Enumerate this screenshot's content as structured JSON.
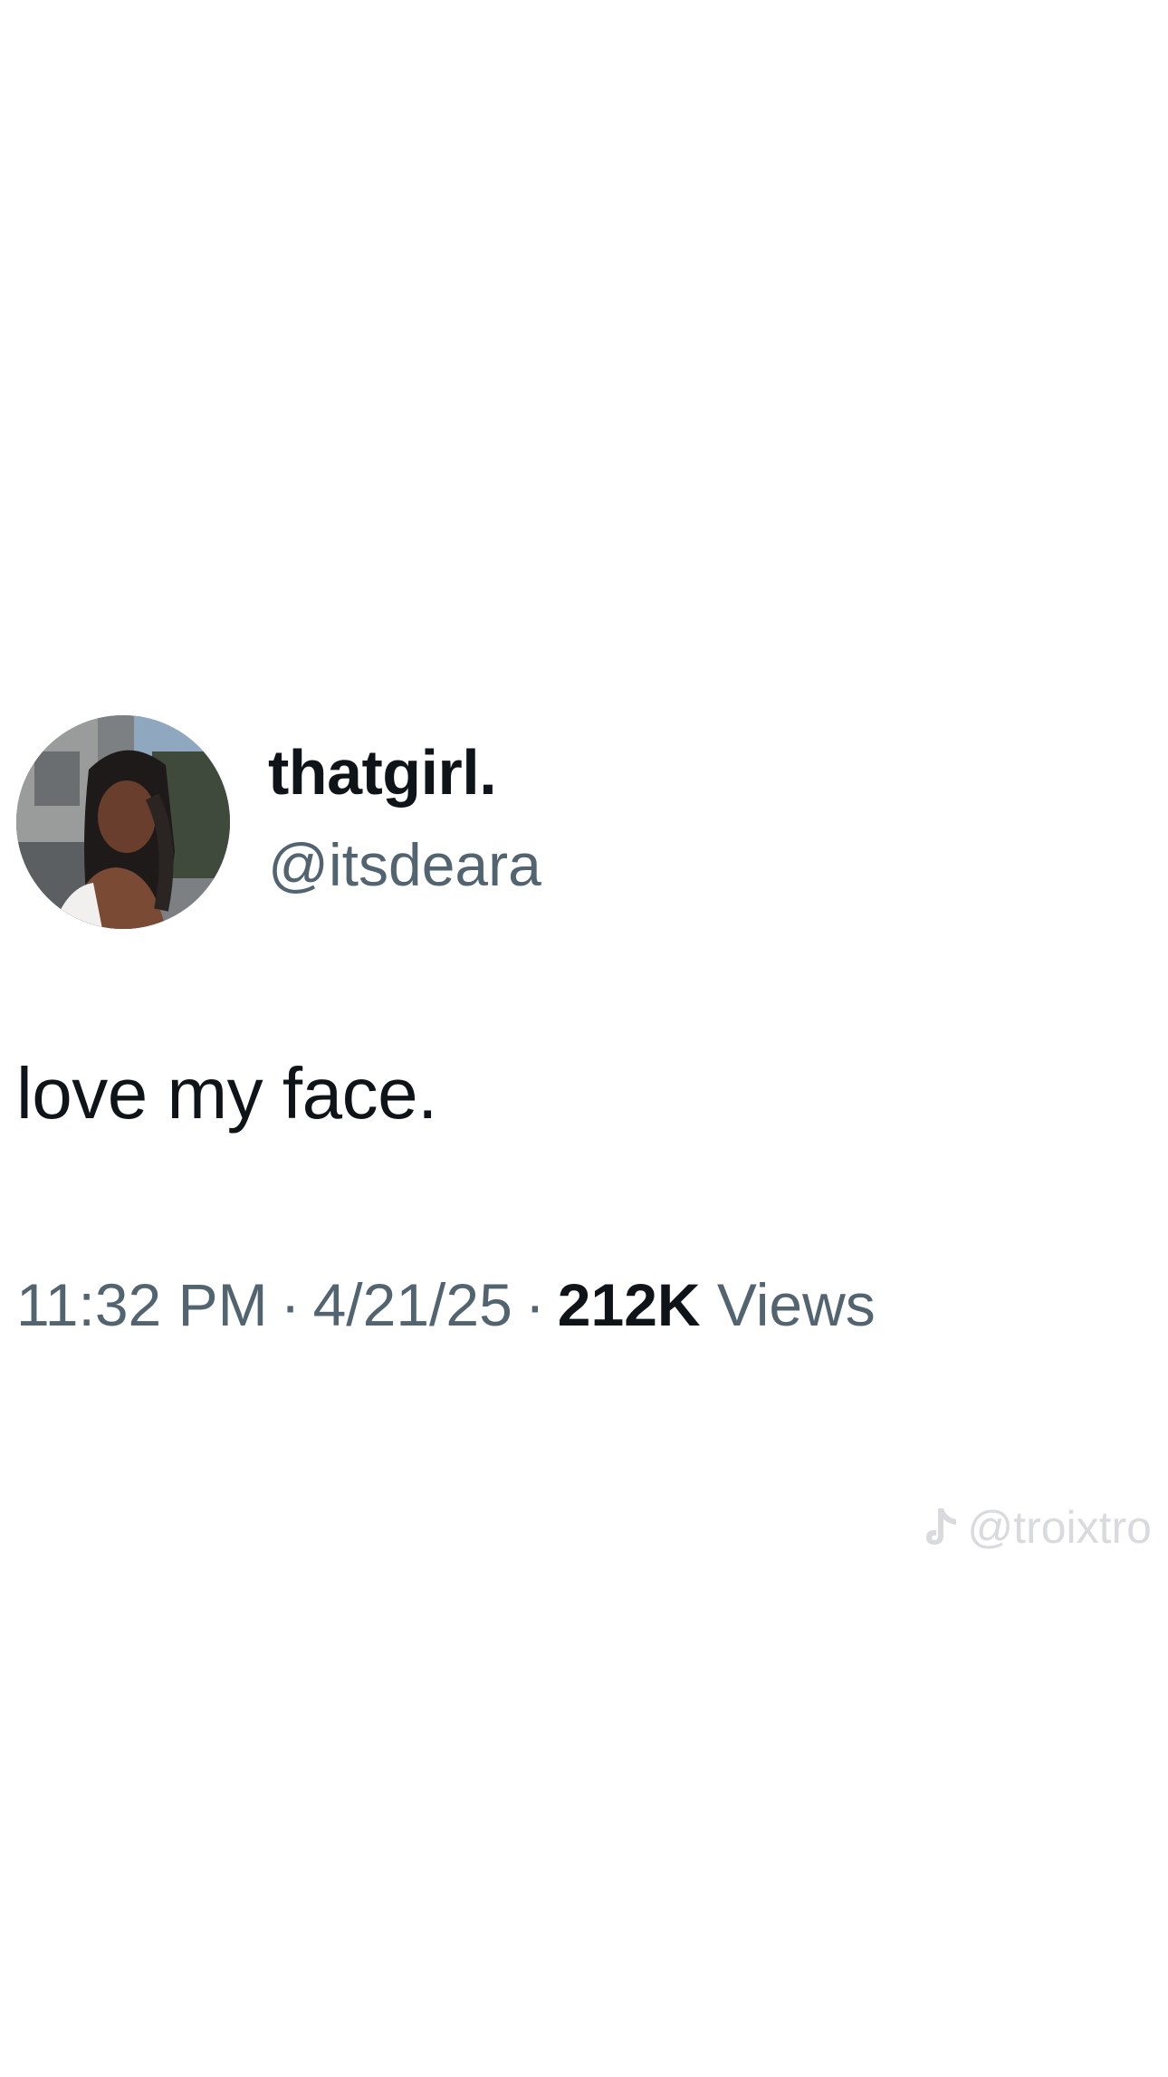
{
  "tweet": {
    "display_name": "thatgirl.",
    "handle": "@itsdeara",
    "text": "love my face.",
    "time": "11:32 PM",
    "date": "4/21/25",
    "separator": "·",
    "views_count": "212K",
    "views_label": "Views"
  },
  "watermark": {
    "icon": "tiktok-icon",
    "text": "@troixtro"
  },
  "colors": {
    "background": "#ffffff",
    "primary_text": "#0f1419",
    "secondary_text": "#536471",
    "watermark": "#d8dade"
  }
}
